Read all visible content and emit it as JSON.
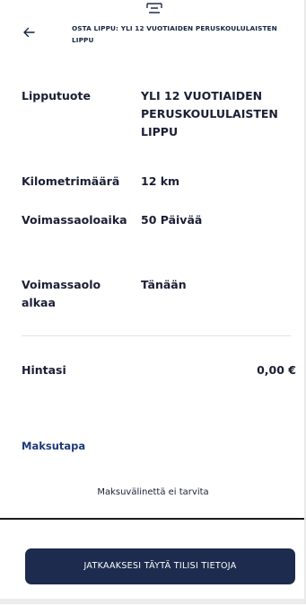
{
  "header": {
    "title": "OSTA LIPPU: YLI 12 VUOTIAIDEN PERUSKOULULAISTEN LIPPU",
    "back_icon": "arrow-left-icon"
  },
  "details": [
    {
      "label": "Lipputuote",
      "value": "YLI 12 VUOTIAIDEN PERUSKOULULAISTEN LIPPU"
    },
    {
      "label": "Kilometrimäärä",
      "value": "12 km"
    },
    {
      "label": "Voimassaoloaika",
      "value": "50 Päivää"
    },
    {
      "label": "Voimassaolo alkaa",
      "value": "Tänään"
    }
  ],
  "price": {
    "label": "Hintasi",
    "value": "0,00 €"
  },
  "payment": {
    "heading": "Maksutapa",
    "note": "Maksuvälinettä ei tarvita"
  },
  "footer": {
    "cta_label": "JATKAAKSESI TÄYTÄ TILISI TIETOJA"
  },
  "colors": {
    "primary_button": "#1c2b4e",
    "link": "#1f3a78",
    "text": "#1a1f35"
  }
}
